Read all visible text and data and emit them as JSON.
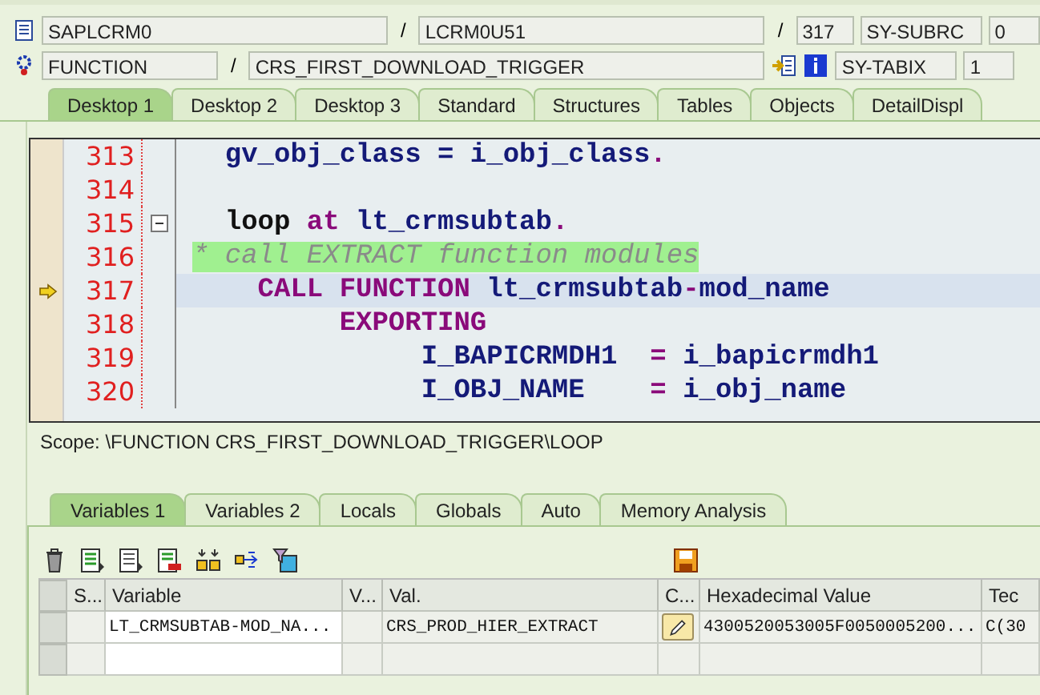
{
  "header": {
    "row1": [
      {
        "kind": "icon"
      },
      {
        "kind": "field",
        "value": "SAPLCRM0"
      },
      {
        "kind": "sep",
        "text": "/"
      },
      {
        "kind": "field",
        "value": "LCRM0U51"
      },
      {
        "kind": "sep",
        "text": "/"
      },
      {
        "kind": "field",
        "value": "317"
      },
      {
        "kind": "field",
        "value": "SY-SUBRC"
      },
      {
        "kind": "field",
        "value": "0"
      }
    ],
    "row2": [
      {
        "kind": "icon"
      },
      {
        "kind": "field",
        "value": "FUNCTION"
      },
      {
        "kind": "sep",
        "text": "/"
      },
      {
        "kind": "field",
        "value": "CRS_FIRST_DOWNLOAD_TRIGGER"
      },
      {
        "kind": "icon"
      },
      {
        "kind": "icon"
      },
      {
        "kind": "field",
        "value": "SY-TABIX"
      },
      {
        "kind": "field",
        "value": "1"
      }
    ]
  },
  "desktop_tabs": [
    {
      "label": "Desktop 1",
      "selected": true
    },
    {
      "label": "Desktop 2",
      "selected": false
    },
    {
      "label": "Desktop 3",
      "selected": false
    },
    {
      "label": "Standard",
      "selected": false
    },
    {
      "label": "Structures",
      "selected": false
    },
    {
      "label": "Tables",
      "selected": false
    },
    {
      "label": "Objects",
      "selected": false
    },
    {
      "label": "DetailDispl",
      "selected": false
    }
  ],
  "code": [
    {
      "number": "313",
      "current": false,
      "fold": false,
      "tokens": [
        {
          "text": "  gv_obj_class = i_obj_class",
          "kind": "id"
        },
        {
          "text": ".",
          "kind": "kw"
        }
      ]
    },
    {
      "number": "314",
      "current": false,
      "fold": false
    },
    {
      "number": "315",
      "current": false,
      "fold": true,
      "tokens": [
        {
          "text": "  loop ",
          "kind": "plain"
        },
        {
          "text": "at ",
          "kind": "kw"
        },
        {
          "text": "lt_crmsubtab",
          "kind": "id"
        },
        {
          "text": ".",
          "kind": "kw"
        }
      ]
    },
    {
      "number": "316",
      "current": false,
      "fold": false,
      "tokens": [
        {
          "text": "* call EXTRACT function modules",
          "kind": "comment"
        }
      ]
    },
    {
      "number": "317",
      "current": true,
      "fold": false,
      "tokens": [
        {
          "text": "    CALL FUNCTION ",
          "kind": "kw"
        },
        {
          "text": "lt_crmsubtab",
          "kind": "id"
        },
        {
          "text": "-",
          "kind": "kw"
        },
        {
          "text": "mod_name",
          "kind": "id"
        }
      ]
    },
    {
      "number": "318",
      "current": false,
      "fold": false,
      "tokens": [
        {
          "text": "         EXPORTING",
          "kind": "kw"
        }
      ]
    },
    {
      "number": "319",
      "current": false,
      "fold": false,
      "tokens": [
        {
          "text": "              I_BAPICRMDH1  ",
          "kind": "id"
        },
        {
          "text": "= ",
          "kind": "kw"
        },
        {
          "text": "i_bapicrmdh1",
          "kind": "id"
        }
      ]
    },
    {
      "number": "320",
      "current": false,
      "fold": false,
      "tokens": [
        {
          "text": "              I_OBJ_NAME    ",
          "kind": "id"
        },
        {
          "text": "= ",
          "kind": "kw"
        },
        {
          "text": "i_obj_name",
          "kind": "id"
        }
      ]
    }
  ],
  "scope": "Scope: \\FUNCTION CRS_FIRST_DOWNLOAD_TRIGGER\\LOOP",
  "variable_tabs": [
    {
      "label": "Variables 1",
      "selected": true
    },
    {
      "label": "Variables 2",
      "selected": false
    },
    {
      "label": "Locals",
      "selected": false
    },
    {
      "label": "Globals",
      "selected": false
    },
    {
      "label": "Auto",
      "selected": false
    },
    {
      "label": "Memory Analysis",
      "selected": false
    }
  ],
  "table": {
    "columns": [
      "S...",
      "Variable",
      "V...",
      "Val.",
      "C...",
      "Hexadecimal Value",
      "Tec"
    ],
    "rows": [
      {
        "cells": [
          {
            "kind": "text"
          },
          {
            "kind": "text",
            "text": "LT_CRMSUBTAB-MOD_NA..."
          },
          {
            "kind": "text"
          },
          {
            "kind": "text",
            "text": "CRS_PROD_HIER_EXTRACT"
          },
          {
            "kind": "edit"
          },
          {
            "kind": "text",
            "text": "4300520053005F0050005200..."
          },
          {
            "kind": "text",
            "text": "C(30"
          }
        ]
      }
    ]
  }
}
